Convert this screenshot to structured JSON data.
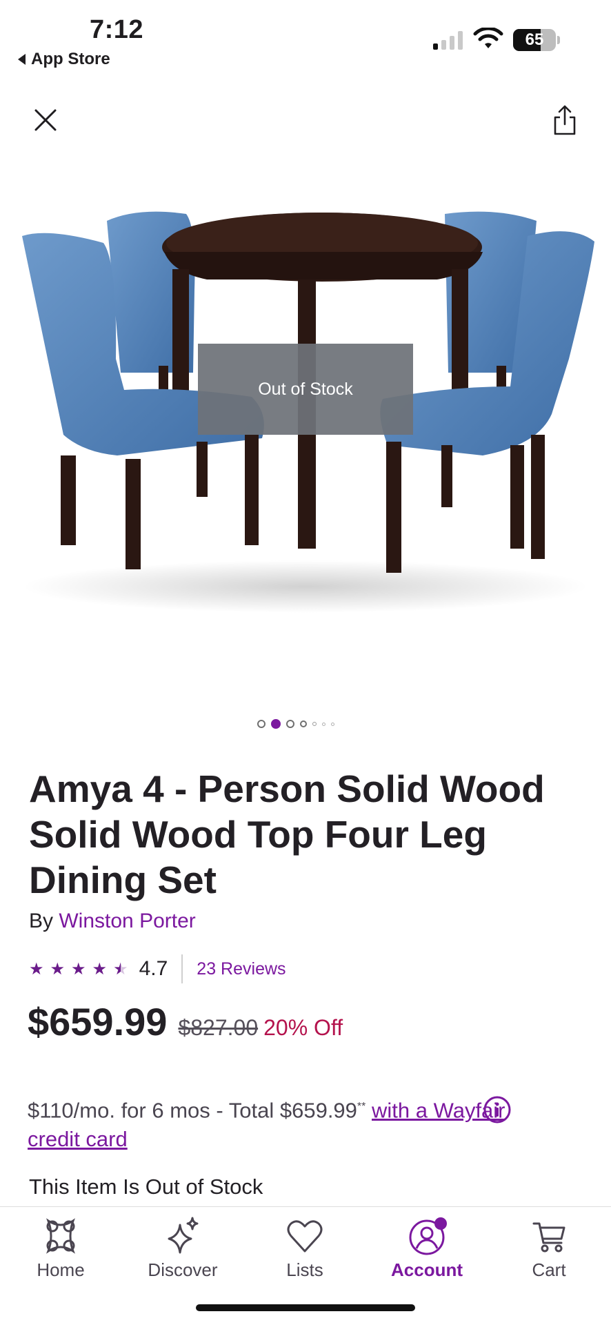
{
  "status_bar": {
    "time": "7:12",
    "back_label": "App Store",
    "battery": "65",
    "battery_level": 0.65
  },
  "product": {
    "image_alt": "Blue upholstered chairs around a round dark wood table",
    "overlay": "Out of Stock",
    "carousel": {
      "count": 7,
      "active_index": 1
    },
    "title": "Amya 4 - Person Solid Wood Solid Wood Top Four Leg Dining Set",
    "brand_prefix": "By",
    "brand": "Winston Porter",
    "rating": "4.7",
    "stars": 4.5,
    "reviews": "23 Reviews",
    "price": "$659.99",
    "was_price": "$827.00",
    "discount": "20% Off",
    "financing_text": "$110/mo. for 6 mos - Total $659.99",
    "financing_mark": "**",
    "financing_link": "with a Wayfair credit card",
    "stock_status": "This Item Is Out of Stock"
  },
  "nav": {
    "items": [
      {
        "label": "Home",
        "icon": "home-icon"
      },
      {
        "label": "Discover",
        "icon": "sparkle-icon"
      },
      {
        "label": "Lists",
        "icon": "heart-icon"
      },
      {
        "label": "Account",
        "icon": "account-icon",
        "active": true,
        "badge": true
      },
      {
        "label": "Cart",
        "icon": "cart-icon"
      }
    ]
  },
  "colors": {
    "brand_purple": "#7b189f",
    "discount_red": "#b4134d",
    "chair_blue": "#4f7fb3",
    "wood_dark": "#2a1712"
  }
}
